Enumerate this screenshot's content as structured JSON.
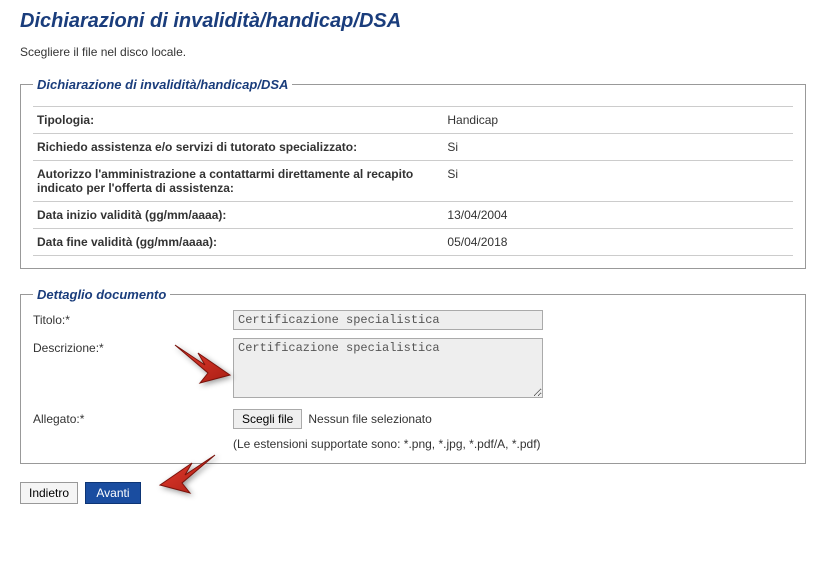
{
  "page": {
    "title": "Dichiarazioni di invalidità/handicap/DSA",
    "subtitle": "Scegliere il file nel disco locale."
  },
  "declaration": {
    "legend": "Dichiarazione di invalidità/handicap/DSA",
    "rows": [
      {
        "label": "Tipologia:",
        "value": "Handicap"
      },
      {
        "label": "Richiedo assistenza e/o servizi di tutorato specializzato:",
        "value": "Si"
      },
      {
        "label": "Autorizzo l'amministrazione a contattarmi direttamente al recapito indicato per l'offerta di assistenza:",
        "value": "Si"
      },
      {
        "label": "Data inizio validità (gg/mm/aaaa):",
        "value": "13/04/2004"
      },
      {
        "label": "Data fine validità (gg/mm/aaaa):",
        "value": "05/04/2018"
      }
    ]
  },
  "document": {
    "legend": "Dettaglio documento",
    "titolo_label": "Titolo:*",
    "titolo_value": "Certificazione specialistica",
    "descrizione_label": "Descrizione:*",
    "descrizione_value": "Certificazione specialistica",
    "allegato_label": "Allegato:*",
    "scegli_file_label": "Scegli file",
    "file_status": "Nessun file selezionato",
    "extensions_note": "(Le estensioni supportate sono: *.png, *.jpg, *.pdf/A, *.pdf)"
  },
  "actions": {
    "back_label": "Indietro",
    "next_label": "Avanti"
  }
}
